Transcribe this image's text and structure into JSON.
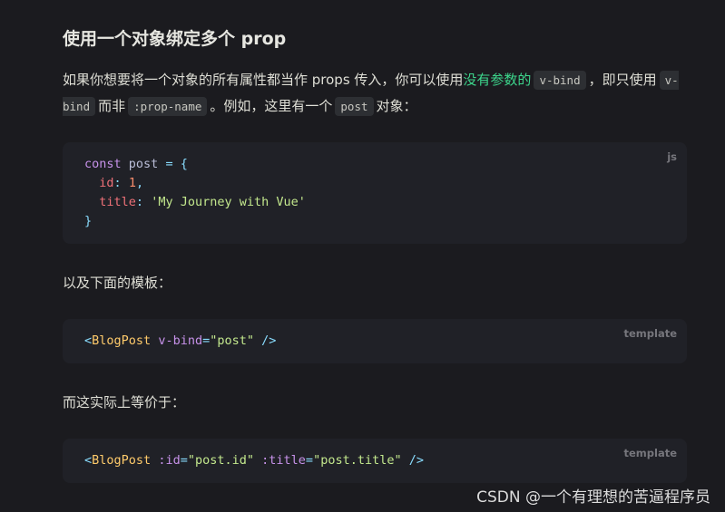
{
  "heading": "使用一个对象绑定多个 prop",
  "para1": {
    "t1": "如果你想要将一个对象的所有属性都当作 props 传入，你可以使用",
    "link": "没有参数的",
    "code1": "v-bind",
    "t2": "，即只使用",
    "code2": "v-bind",
    "t3": "而非",
    "code3": ":prop-name",
    "t4": "。例如，这里有一个",
    "code4": "post",
    "t5": "对象："
  },
  "block1": {
    "lang": "js",
    "kw": "const",
    "var": "post",
    "eq": "=",
    "open": "{",
    "key1": "id",
    "val1": "1",
    "key2": "title",
    "val2": "'My Journey with Vue'",
    "close": "}"
  },
  "para2": "以及下面的模板：",
  "block2": {
    "lang": "template",
    "lt": "<",
    "tag": "BlogPost",
    "attr": "v-bind",
    "eq": "=",
    "val": "\"post\"",
    "end": "/>"
  },
  "para3": "而这实际上等价于：",
  "block3": {
    "lang": "template",
    "lt": "<",
    "tag": "BlogPost",
    "attr1": ":id",
    "eq": "=",
    "val1": "\"post.id\"",
    "attr2": ":title",
    "val2": "\"post.title\"",
    "end": "/>"
  },
  "watermark": "CSDN @一个有理想的苦逼程序员"
}
